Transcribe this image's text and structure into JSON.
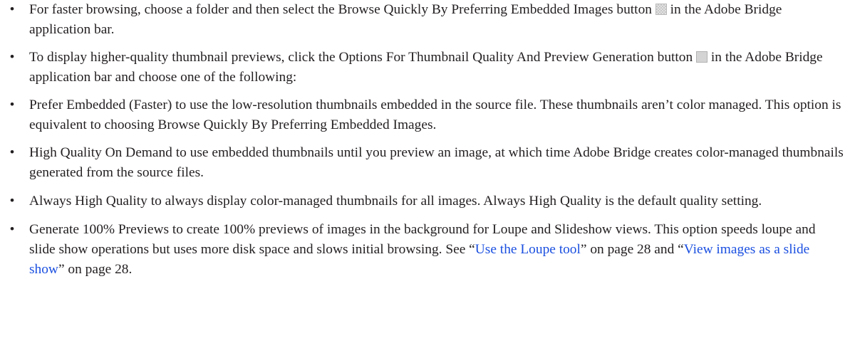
{
  "bullet_char": "•",
  "items": [
    {
      "text_before_icon": "For faster browsing, choose a folder and then select the Browse Quickly By Preferring Embedded Images button ",
      "icon": "browse-quickly-icon",
      "text_after_icon": " in the Adobe Bridge application bar."
    },
    {
      "text_before_icon": "To display higher-quality thumbnail previews, click the Options For Thumbnail Quality And Preview Generation button ",
      "icon": "thumbnail-quality-options-icon",
      "text_after_icon": " in the Adobe Bridge application bar and choose one of the following:"
    },
    {
      "text": "Prefer Embedded (Faster) to use the low-resolution thumbnails embedded in the source file. These thumbnails aren’t color managed. This option is equivalent to choosing Browse Quickly By Preferring Embedded Images."
    },
    {
      "text": "High Quality On Demand to use embedded thumbnails until you preview an image, at which time Adobe Bridge creates color-managed thumbnails generated from the source files."
    },
    {
      "text": "Always High Quality to always display color-managed thumbnails for all images. Always High Quality is the default quality setting."
    },
    {
      "text_start": "Generate 100% Previews to create 100% previews of images in the background for Loupe and Slideshow views. This option speeds loupe and slide show operations but uses more disk space and slows initial browsing. See “",
      "link1": "Use the Loupe tool",
      "text_mid": "” on page 28 and “",
      "link2": "View images as a slide show",
      "text_end": "” on page 28."
    }
  ]
}
